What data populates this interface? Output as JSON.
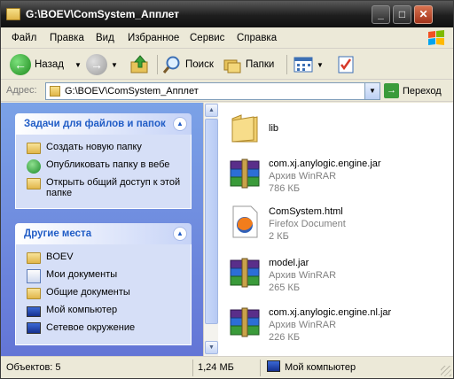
{
  "window": {
    "title": "G:\\BOEV\\ComSystem_Апплет"
  },
  "title_buttons": {
    "minimize": "_",
    "maximize": "□",
    "close": "✕"
  },
  "menu": [
    "Файл",
    "Правка",
    "Вид",
    "Избранное",
    "Сервис",
    "Справка"
  ],
  "toolbar": {
    "back_label": "Назад",
    "search_label": "Поиск",
    "folders_label": "Папки"
  },
  "address": {
    "label": "Адрес:",
    "path": "G:\\BOEV\\ComSystem_Апплет",
    "go_label": "Переход"
  },
  "tasks_panel": {
    "title": "Задачи для файлов и папок",
    "items": [
      {
        "label": "Создать новую папку",
        "icon": "new-folder-icon"
      },
      {
        "label": "Опубликовать папку в вебе",
        "icon": "publish-web-icon"
      },
      {
        "label": "Открыть общий доступ к этой папке",
        "icon": "share-folder-icon"
      }
    ]
  },
  "places_panel": {
    "title": "Другие места",
    "items": [
      {
        "label": "BOEV",
        "icon": "folder-icon"
      },
      {
        "label": "Мои документы",
        "icon": "documents-icon"
      },
      {
        "label": "Общие документы",
        "icon": "folder-icon"
      },
      {
        "label": "Мой компьютер",
        "icon": "computer-icon"
      },
      {
        "label": "Сетевое окружение",
        "icon": "network-icon"
      }
    ]
  },
  "files": [
    {
      "name": "lib",
      "type": "",
      "size": "",
      "icon": "folder-icon"
    },
    {
      "name": "com.xj.anylogic.engine.jar",
      "type": "Архив WinRAR",
      "size": "786 КБ",
      "icon": "winrar-archive-icon"
    },
    {
      "name": "ComSystem.html",
      "type": "Firefox Document",
      "size": "2 КБ",
      "icon": "firefox-document-icon"
    },
    {
      "name": "model.jar",
      "type": "Архив WinRAR",
      "size": "265 КБ",
      "icon": "winrar-archive-icon"
    },
    {
      "name": "com.xj.anylogic.engine.nl.jar",
      "type": "Архив WinRAR",
      "size": "226 КБ",
      "icon": "winrar-archive-icon"
    }
  ],
  "status": {
    "objects": "Объектов: 5",
    "size": "1,24 МБ",
    "location": "Мой компьютер"
  },
  "colors": {
    "taskpane_top": "#7ba2e7",
    "panel_title": "#215dc6",
    "titlebar": "#1e1e1e"
  }
}
